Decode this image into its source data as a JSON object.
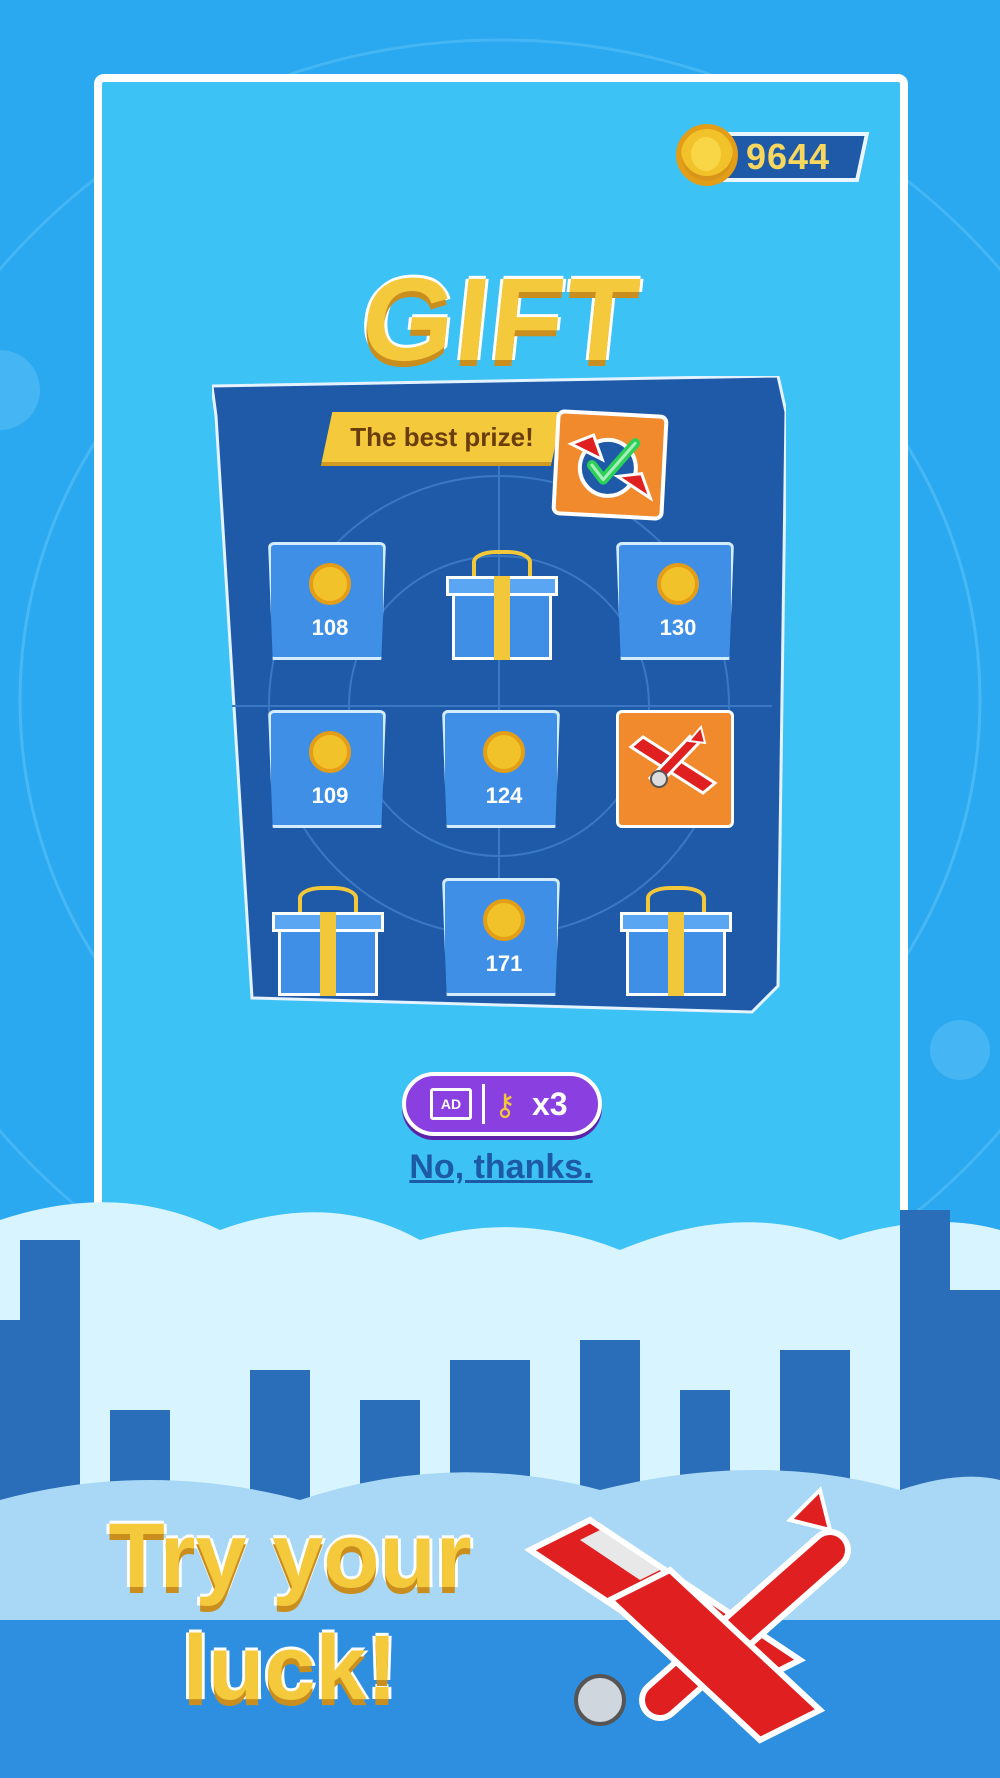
{
  "coins": {
    "value": "9644",
    "icon": "coin-icon"
  },
  "title": "GIFT",
  "best_prize": {
    "label": "The best prize!",
    "icon": "plane-check-icon"
  },
  "grid": {
    "cells": [
      {
        "type": "coin",
        "value": "108"
      },
      {
        "type": "gift"
      },
      {
        "type": "coin",
        "value": "130"
      },
      {
        "type": "coin",
        "value": "109"
      },
      {
        "type": "coin",
        "value": "124"
      },
      {
        "type": "plane"
      },
      {
        "type": "gift"
      },
      {
        "type": "coin",
        "value": "171"
      },
      {
        "type": "gift"
      }
    ]
  },
  "ad_button": {
    "tv_label": "AD",
    "count": "x3",
    "icon": "key-icon"
  },
  "no_thanks": "No, thanks.",
  "tagline": {
    "line1": "Try your",
    "line2": "luck!"
  },
  "colors": {
    "accent": "#f4c93c",
    "board": "#1e5aa8",
    "tile": "#3f8fe6",
    "orange": "#f18a2c",
    "purple": "#8a3fe0"
  }
}
